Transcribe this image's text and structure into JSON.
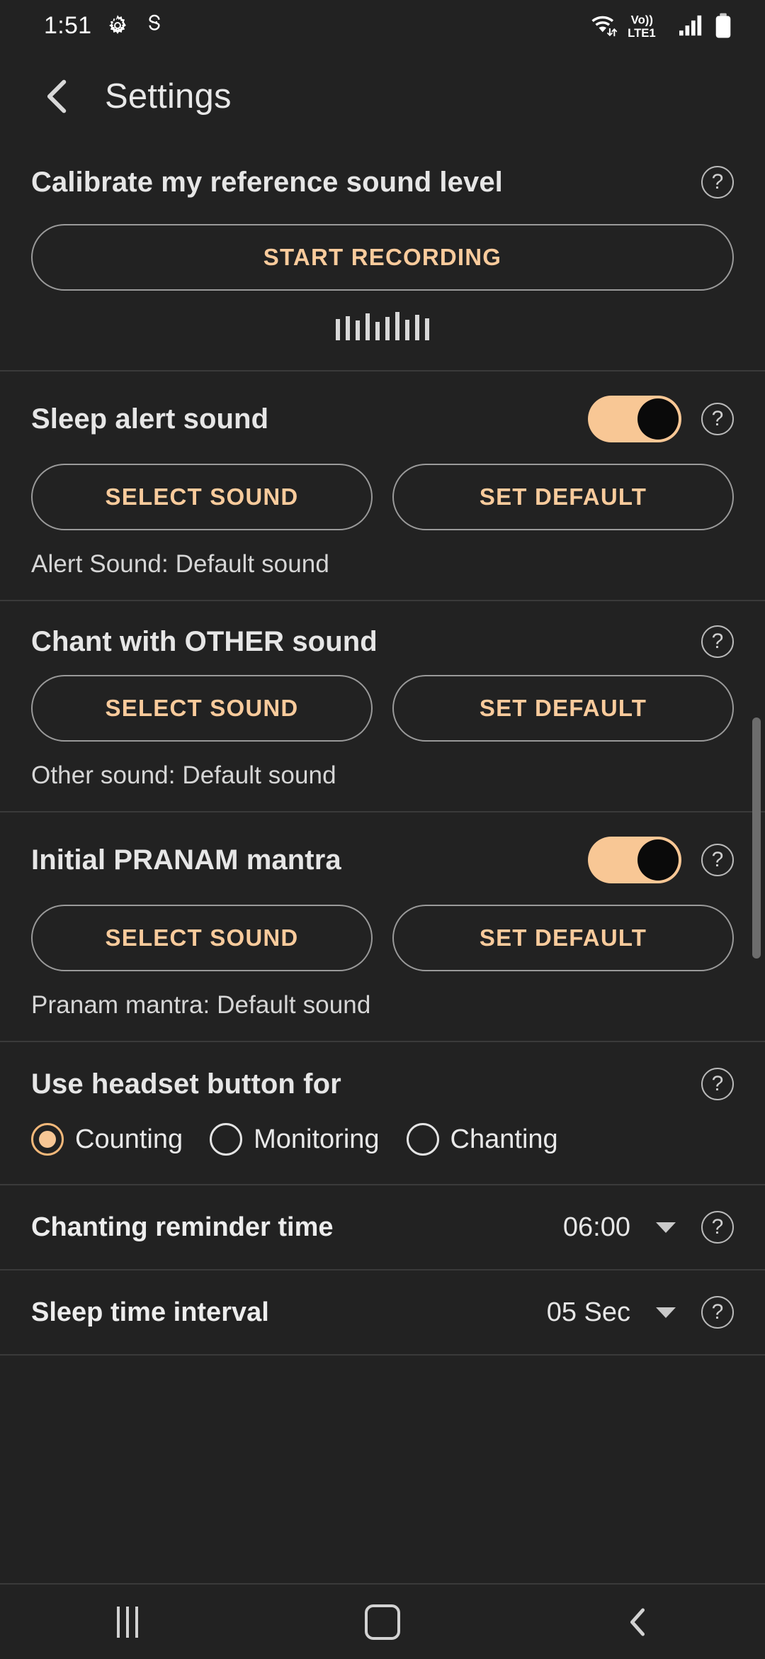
{
  "status_bar": {
    "time": "1:51",
    "icons_left": [
      "settings-gear-icon",
      "app-notification-icon"
    ],
    "network_label": "LTE1",
    "volte_label": "Vo))",
    "icons_right": [
      "wifi-icon",
      "volte-icon",
      "signal-bars-icon",
      "battery-icon"
    ]
  },
  "app_bar": {
    "back_icon": "chevron-left-icon",
    "title": "Settings"
  },
  "calibrate": {
    "title": "Calibrate my reference sound level",
    "help_icon": "help-circle-icon",
    "button_label": "START RECORDING",
    "wave_bars": [
      30,
      34,
      28,
      38,
      26,
      33,
      40,
      29,
      36,
      31
    ]
  },
  "sleep_alert": {
    "title": "Sleep alert sound",
    "toggle_on": true,
    "help_icon": "help-circle-icon",
    "select_label": "SELECT SOUND",
    "default_label": "SET DEFAULT",
    "note": "Alert Sound: Default sound"
  },
  "chant_other": {
    "title": "Chant with OTHER sound",
    "help_icon": "help-circle-icon",
    "select_label": "SELECT SOUND",
    "default_label": "SET DEFAULT",
    "note": "Other sound: Default sound"
  },
  "pranam": {
    "title": "Initial PRANAM mantra",
    "toggle_on": true,
    "help_icon": "help-circle-icon",
    "select_label": "SELECT SOUND",
    "default_label": "SET DEFAULT",
    "note": "Pranam mantra: Default sound"
  },
  "headset": {
    "title": "Use headset button for",
    "help_icon": "help-circle-icon",
    "options": [
      {
        "label": "Counting",
        "selected": true
      },
      {
        "label": "Monitoring",
        "selected": false
      },
      {
        "label": "Chanting",
        "selected": false
      }
    ]
  },
  "reminder_time": {
    "label": "Chanting reminder time",
    "value": "06:00",
    "caret_icon": "chevron-down-icon",
    "help_icon": "help-circle-icon"
  },
  "sleep_interval": {
    "label": "Sleep time interval",
    "value": "05 Sec",
    "caret_icon": "chevron-down-icon",
    "help_icon": "help-circle-icon"
  },
  "nav_bar": {
    "recents_icon": "recents-icon",
    "home_icon": "home-icon",
    "back_icon": "back-chevron-icon"
  },
  "colors": {
    "background": "#222222",
    "accent": "#f9cb9c",
    "toggle_on": "#f8c795",
    "divider": "#3a3a3a",
    "text_primary": "#e8e8e8"
  }
}
